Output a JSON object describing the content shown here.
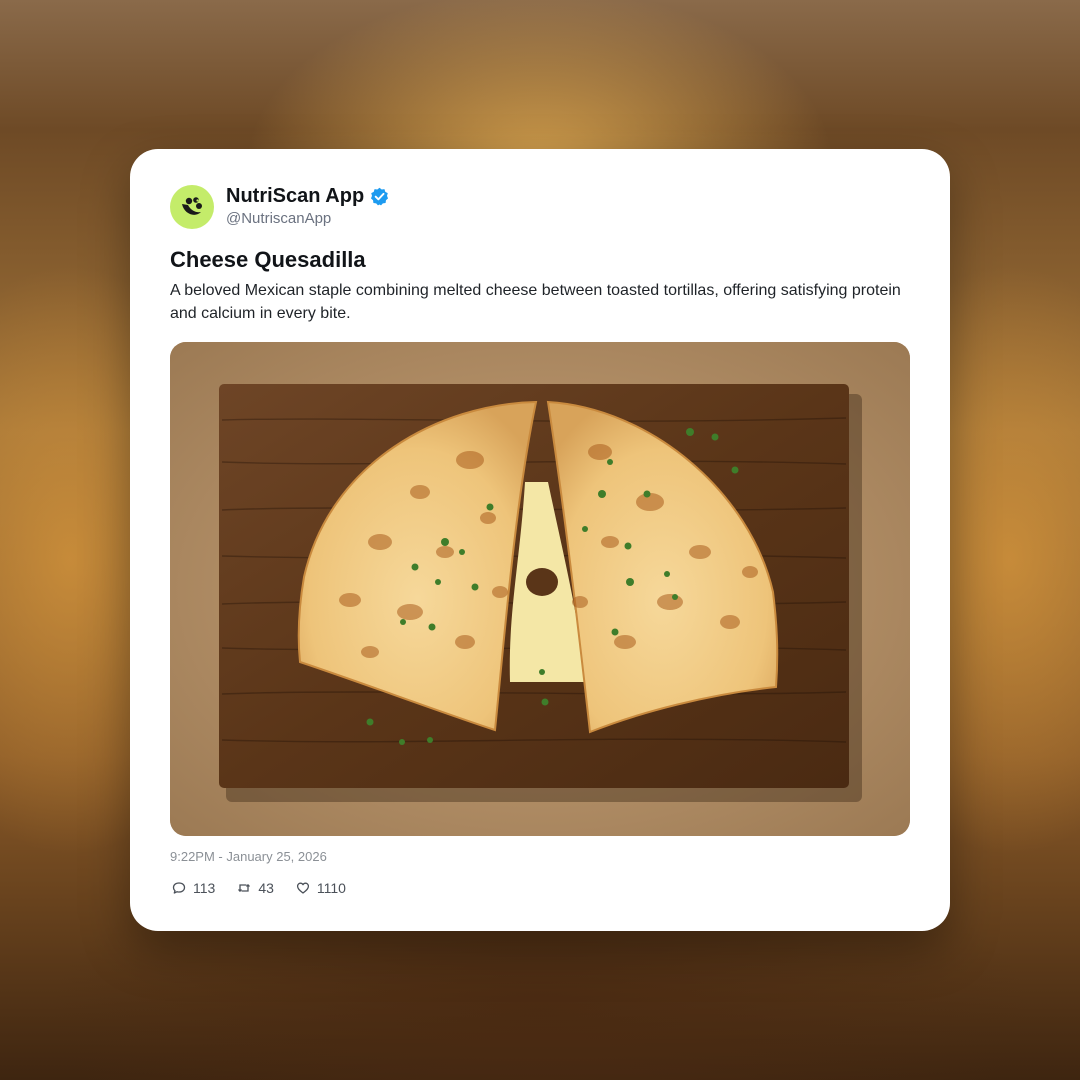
{
  "post": {
    "author": {
      "display_name": "NutriScan App",
      "handle": "@NutriscanApp",
      "verified": true,
      "avatar_icon": "nutriscan-logo-icon",
      "avatar_color": "#c4ec6a",
      "verified_color": "#1d9bf0"
    },
    "title": "Cheese Quesadilla",
    "text": "A beloved Mexican staple combining melted cheese between toasted tortillas, offering satisfying protein and calcium in every bite.",
    "image_icon": "quesadilla-photo",
    "timestamp": "9:22PM - January 25, 2026",
    "stats": {
      "replies": "113",
      "reposts": "43",
      "likes": "1110"
    },
    "icons": {
      "replies": "comment-icon",
      "reposts": "repost-icon",
      "likes": "heart-icon"
    }
  }
}
